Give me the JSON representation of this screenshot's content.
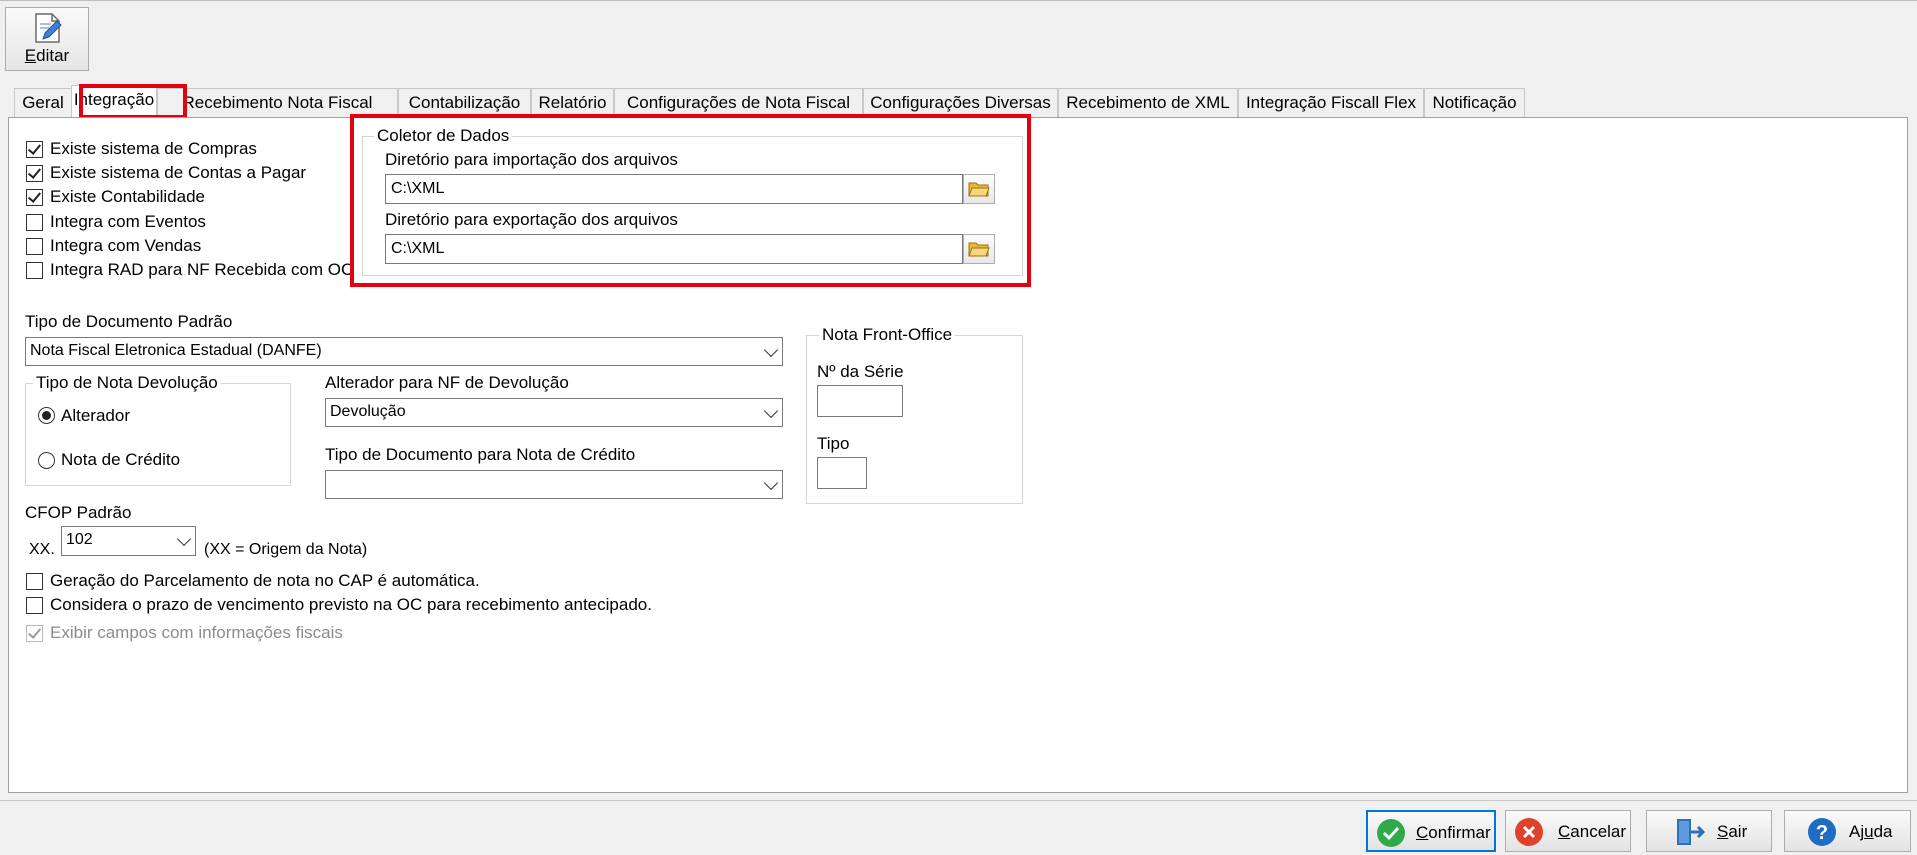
{
  "toolbar": {
    "edit_label_mnemonic": "E",
    "edit_label_rest": "ditar"
  },
  "tabs": [
    {
      "label": "Geral"
    },
    {
      "label": "Integração"
    },
    {
      "label": "Recebimento Nota Fiscal"
    },
    {
      "label": "Contabilização"
    },
    {
      "label": "Relatório"
    },
    {
      "label": "Configurações de Nota Fiscal"
    },
    {
      "label": "Configurações Diversas"
    },
    {
      "label": "Recebimento de XML"
    },
    {
      "label": "Integração Fiscall Flex"
    },
    {
      "label": "Notificação"
    }
  ],
  "active_tab": "Integração",
  "options": [
    {
      "label": "Existe sistema de Compras",
      "checked": true
    },
    {
      "label": "Existe sistema de Contas a Pagar",
      "checked": true
    },
    {
      "label": "Existe Contabilidade",
      "checked": true
    },
    {
      "label": "Integra com Eventos",
      "checked": false
    },
    {
      "label": "Integra com Vendas",
      "checked": false
    },
    {
      "label": "Integra RAD para NF Recebida com OC",
      "checked": false
    }
  ],
  "coletor": {
    "title": "Coletor de Dados",
    "import_label": "Diretório para importação dos arquivos",
    "import_value": "C:\\XML",
    "export_label": "Diretório para exportação dos arquivos",
    "export_value": "C:\\XML"
  },
  "tipo_documento": {
    "label": "Tipo de Documento Padrão",
    "value": "Nota Fiscal Eletronica Estadual (DANFE)"
  },
  "tipo_nota_devolucao": {
    "title": "Tipo de Nota Devolução",
    "options": [
      {
        "label": "Alterador",
        "selected": true
      },
      {
        "label": "Nota de Crédito",
        "selected": false
      }
    ]
  },
  "alterador_nf": {
    "label": "Alterador para NF de Devolução",
    "value": "Devolução"
  },
  "tipo_doc_credito": {
    "label": "Tipo de Documento para Nota de Crédito",
    "value": ""
  },
  "nota_front_office": {
    "title": "Nota Front-Office",
    "serie_label": "Nº da Série",
    "serie_value": "",
    "tipo_label": "Tipo",
    "tipo_value": ""
  },
  "cfop": {
    "label": "CFOP Padrão",
    "prefix": "XX.",
    "value": "102",
    "hint": "(XX = Origem da Nota)"
  },
  "bottom_options": [
    {
      "label": "Geração do Parcelamento de nota no CAP é automática.",
      "checked": false,
      "disabled": false
    },
    {
      "label": "Considera o prazo de vencimento previsto na OC para recebimento antecipado.",
      "checked": false,
      "disabled": false
    },
    {
      "label": "Exibir campos com informações fiscais",
      "checked": true,
      "disabled": true
    }
  ],
  "footer": {
    "confirmar": {
      "mnemonic": "C",
      "rest": "onfirmar"
    },
    "cancelar": {
      "mnemonic": "C",
      "rest": "ancelar"
    },
    "sair": {
      "mnemonic": "S",
      "rest": "air"
    },
    "ajuda": {
      "pre": "Aj",
      "mnemonic": "u",
      "rest": "da"
    }
  },
  "colors": {
    "highlight": "#e3000f",
    "confirm": "#2eaa4a",
    "cancel": "#e0412b",
    "exit": "#2f6fb5",
    "help": "#1f6dc2",
    "folder": "#f2c94c"
  }
}
